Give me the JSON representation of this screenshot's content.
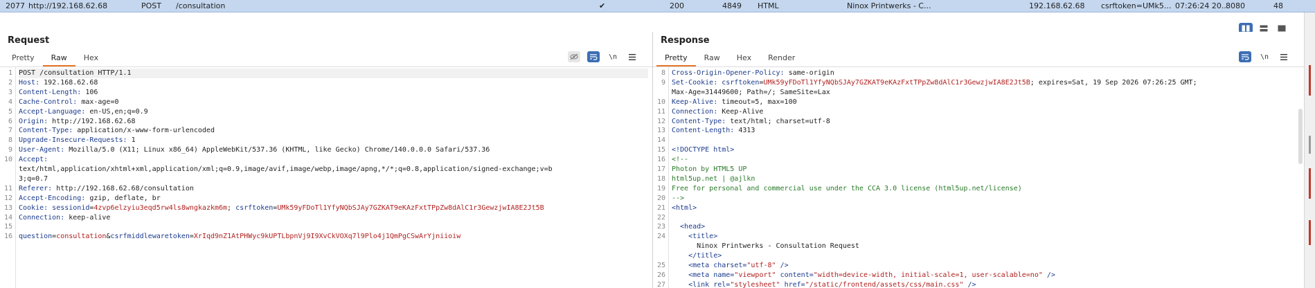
{
  "history_row": {
    "id": "2077",
    "host": "http://192.168.62.68",
    "method": "POST",
    "url": "/consultation",
    "checked": "✔",
    "status": "200",
    "length": "4849",
    "mime": "HTML",
    "title": "Ninox Printwerks - C...",
    "ip": "192.168.62.68",
    "cookies": "csrftoken=UMk5...",
    "time": "07:26:24 20...",
    "port": "8080",
    "tls": "48"
  },
  "request": {
    "title": "Request",
    "tabs": [
      "Pretty",
      "Raw",
      "Hex"
    ],
    "active_tab": "Raw",
    "tools": {
      "hide_icon": "eye-off-icon",
      "wrap_icon": "wrap-lines-icon",
      "newline_label": "\\n",
      "menu_icon": "hamburger-menu-icon"
    },
    "lines": [
      {
        "n": "1",
        "parts": [
          {
            "t": "POST /consultation HTTP/1.1",
            "c": "v"
          }
        ]
      },
      {
        "n": "2",
        "parts": [
          {
            "t": "Host: ",
            "c": "k"
          },
          {
            "t": "192.168.62.68",
            "c": "v"
          }
        ]
      },
      {
        "n": "3",
        "parts": [
          {
            "t": "Content-Length: ",
            "c": "k"
          },
          {
            "t": "106",
            "c": "v"
          }
        ]
      },
      {
        "n": "4",
        "parts": [
          {
            "t": "Cache-Control: ",
            "c": "k"
          },
          {
            "t": "max-age=0",
            "c": "v"
          }
        ]
      },
      {
        "n": "5",
        "parts": [
          {
            "t": "Accept-Language: ",
            "c": "k"
          },
          {
            "t": "en-US,en;q=0.9",
            "c": "v"
          }
        ]
      },
      {
        "n": "6",
        "parts": [
          {
            "t": "Origin: ",
            "c": "k"
          },
          {
            "t": "http://192.168.62.68",
            "c": "v"
          }
        ]
      },
      {
        "n": "7",
        "parts": [
          {
            "t": "Content-Type: ",
            "c": "k"
          },
          {
            "t": "application/x-www-form-urlencoded",
            "c": "v"
          }
        ]
      },
      {
        "n": "8",
        "parts": [
          {
            "t": "Upgrade-Insecure-Requests: ",
            "c": "k"
          },
          {
            "t": "1",
            "c": "v"
          }
        ]
      },
      {
        "n": "9",
        "parts": [
          {
            "t": "User-Agent: ",
            "c": "k"
          },
          {
            "t": "Mozilla/5.0 (X11; Linux x86_64) AppleWebKit/537.36 (KHTML, like Gecko) Chrome/140.0.0.0 Safari/537.36",
            "c": "v"
          }
        ]
      },
      {
        "n": "10",
        "parts": [
          {
            "t": "Accept: ",
            "c": "k"
          }
        ]
      },
      {
        "n": "",
        "parts": [
          {
            "t": "text/html,application/xhtml+xml,application/xml;q=0.9,image/avif,image/webp,image/apng,*/*;q=0.8,application/signed-exchange;v=b",
            "c": "v"
          }
        ]
      },
      {
        "n": "",
        "parts": [
          {
            "t": "3;q=0.7",
            "c": "v"
          }
        ]
      },
      {
        "n": "11",
        "parts": [
          {
            "t": "Referer: ",
            "c": "k"
          },
          {
            "t": "http://192.168.62.68/consultation",
            "c": "v"
          }
        ]
      },
      {
        "n": "12",
        "parts": [
          {
            "t": "Accept-Encoding: ",
            "c": "k"
          },
          {
            "t": "gzip, deflate, br",
            "c": "v"
          }
        ]
      },
      {
        "n": "13",
        "parts": [
          {
            "t": "Cookie: ",
            "c": "k"
          },
          {
            "t": "sessionid",
            "c": "bl"
          },
          {
            "t": "=",
            "c": "v"
          },
          {
            "t": "4zvp6elzyiu3eqd5rw4ls8wngkazkm6m",
            "c": "rd"
          },
          {
            "t": "; ",
            "c": "v"
          },
          {
            "t": "csrftoken",
            "c": "bl"
          },
          {
            "t": "=",
            "c": "v"
          },
          {
            "t": "UMk59yFDoTl1YfyNQbSJAy7GZKAT9eKAzFxtTPpZw8dAlC1r3GewzjwIA8E2Jt5B",
            "c": "rd"
          }
        ]
      },
      {
        "n": "14",
        "parts": [
          {
            "t": "Connection: ",
            "c": "k"
          },
          {
            "t": "keep-alive",
            "c": "v"
          }
        ]
      },
      {
        "n": "15",
        "parts": []
      },
      {
        "n": "16",
        "parts": [
          {
            "t": "question",
            "c": "bl"
          },
          {
            "t": "=",
            "c": "v"
          },
          {
            "t": "consultation",
            "c": "rd"
          },
          {
            "t": "&",
            "c": "v"
          },
          {
            "t": "csrfmiddlewaretoken",
            "c": "bl"
          },
          {
            "t": "=",
            "c": "v"
          },
          {
            "t": "XrIqd9nZ1AtPHWyc9kUPTLbpnVj9I9XvCkVOXq7l9Plo4j1QmPgCSwArYjniioiw",
            "c": "rd"
          }
        ]
      }
    ]
  },
  "response": {
    "title": "Response",
    "tabs": [
      "Pretty",
      "Raw",
      "Hex",
      "Render"
    ],
    "active_tab": "Pretty",
    "tools": {
      "wrap_icon": "wrap-lines-icon",
      "newline_label": "\\n",
      "menu_icon": "hamburger-menu-icon"
    },
    "lines": [
      {
        "n": "8",
        "parts": [
          {
            "t": "Cross-Origin-Opener-Policy: ",
            "c": "k"
          },
          {
            "t": "same-origin",
            "c": "v"
          }
        ]
      },
      {
        "n": "9",
        "parts": [
          {
            "t": "Set-Cookie: ",
            "c": "k"
          },
          {
            "t": "csrftoken",
            "c": "bl"
          },
          {
            "t": "=",
            "c": "v"
          },
          {
            "t": "UMk59yFDoTl1YfyNQbSJAy7GZKAT9eKAzFxtTPpZw8dAlC1r3GewzjwIA8E2Jt5B",
            "c": "rd"
          },
          {
            "t": "; expires=Sat, 19 Sep 2026 07:26:25 GMT;",
            "c": "v"
          }
        ]
      },
      {
        "n": "",
        "parts": [
          {
            "t": "Max-Age=31449600; Path=/; SameSite=Lax",
            "c": "v"
          }
        ]
      },
      {
        "n": "10",
        "parts": [
          {
            "t": "Keep-Alive: ",
            "c": "k"
          },
          {
            "t": "timeout=5, max=100",
            "c": "v"
          }
        ]
      },
      {
        "n": "11",
        "parts": [
          {
            "t": "Connection: ",
            "c": "k"
          },
          {
            "t": "Keep-Alive",
            "c": "v"
          }
        ]
      },
      {
        "n": "12",
        "parts": [
          {
            "t": "Content-Type: ",
            "c": "k"
          },
          {
            "t": "text/html; charset=utf-8",
            "c": "v"
          }
        ]
      },
      {
        "n": "13",
        "parts": [
          {
            "t": "Content-Length: ",
            "c": "k"
          },
          {
            "t": "4313",
            "c": "v"
          }
        ]
      },
      {
        "n": "14",
        "parts": []
      },
      {
        "n": "15",
        "parts": [
          {
            "t": "<!DOCTYPE html>",
            "c": "tag"
          }
        ]
      },
      {
        "n": "16",
        "parts": [
          {
            "t": "<!--",
            "c": "grn"
          }
        ]
      },
      {
        "n": "17",
        "parts": [
          {
            "t": "Photon by HTML5 UP",
            "c": "grn"
          }
        ]
      },
      {
        "n": "18",
        "parts": [
          {
            "t": "html5up.net | @ajlkn",
            "c": "grn"
          }
        ]
      },
      {
        "n": "19",
        "parts": [
          {
            "t": "Free for personal and commercial use under the CCA 3.0 license (html5up.net/license)",
            "c": "grn"
          }
        ]
      },
      {
        "n": "20",
        "parts": [
          {
            "t": "-->",
            "c": "grn"
          }
        ]
      },
      {
        "n": "21",
        "parts": [
          {
            "t": "<html>",
            "c": "tag"
          }
        ]
      },
      {
        "n": "22",
        "parts": []
      },
      {
        "n": "23",
        "parts": [
          {
            "t": "  <head>",
            "c": "tag"
          }
        ]
      },
      {
        "n": "24",
        "parts": [
          {
            "t": "    <title>",
            "c": "tag"
          }
        ]
      },
      {
        "n": "",
        "parts": [
          {
            "t": "      Ninox Printwerks - Consultation Request",
            "c": "v"
          }
        ]
      },
      {
        "n": "",
        "parts": [
          {
            "t": "    </title>",
            "c": "tag"
          }
        ]
      },
      {
        "n": "25",
        "parts": [
          {
            "t": "    <meta ",
            "c": "tag"
          },
          {
            "t": "charset=",
            "c": "bl"
          },
          {
            "t": "\"utf-8\"",
            "c": "str"
          },
          {
            "t": " />",
            "c": "tag"
          }
        ]
      },
      {
        "n": "26",
        "parts": [
          {
            "t": "    <meta ",
            "c": "tag"
          },
          {
            "t": "name=",
            "c": "bl"
          },
          {
            "t": "\"viewport\"",
            "c": "str"
          },
          {
            "t": " content=",
            "c": "bl"
          },
          {
            "t": "\"width=device-width, initial-scale=1, user-scalable=no\"",
            "c": "str"
          },
          {
            "t": " />",
            "c": "tag"
          }
        ]
      },
      {
        "n": "27",
        "parts": [
          {
            "t": "    <link ",
            "c": "tag"
          },
          {
            "t": "rel=",
            "c": "bl"
          },
          {
            "t": "\"stylesheet\"",
            "c": "str"
          },
          {
            "t": " href=",
            "c": "bl"
          },
          {
            "t": "\"/static/frontend/assets/css/main.css\"",
            "c": "str"
          },
          {
            "t": " />",
            "c": "tag"
          }
        ]
      }
    ]
  }
}
